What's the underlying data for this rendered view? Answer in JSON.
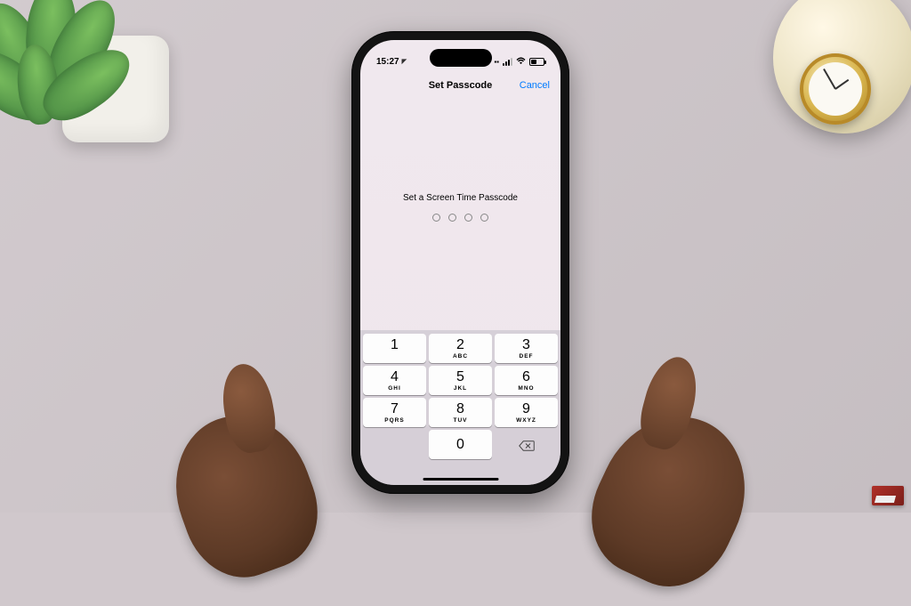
{
  "statusbar": {
    "time": "15:27",
    "location_indicator": "➤"
  },
  "navbar": {
    "title": "Set Passcode",
    "cancel_label": "Cancel"
  },
  "prompt": {
    "text": "Set a Screen Time Passcode"
  },
  "passcode": {
    "digits_entered": 0,
    "total_digits": 4
  },
  "keypad": {
    "rows": [
      [
        {
          "num": "1",
          "let": ""
        },
        {
          "num": "2",
          "let": "ABC"
        },
        {
          "num": "3",
          "let": "DEF"
        }
      ],
      [
        {
          "num": "4",
          "let": "GHI"
        },
        {
          "num": "5",
          "let": "JKL"
        },
        {
          "num": "6",
          "let": "MNO"
        }
      ],
      [
        {
          "num": "7",
          "let": "PQRS"
        },
        {
          "num": "8",
          "let": "TUV"
        },
        {
          "num": "9",
          "let": "WXYZ"
        }
      ],
      [
        {
          "blank": true
        },
        {
          "num": "0",
          "let": ""
        },
        {
          "delete": true
        }
      ]
    ]
  }
}
